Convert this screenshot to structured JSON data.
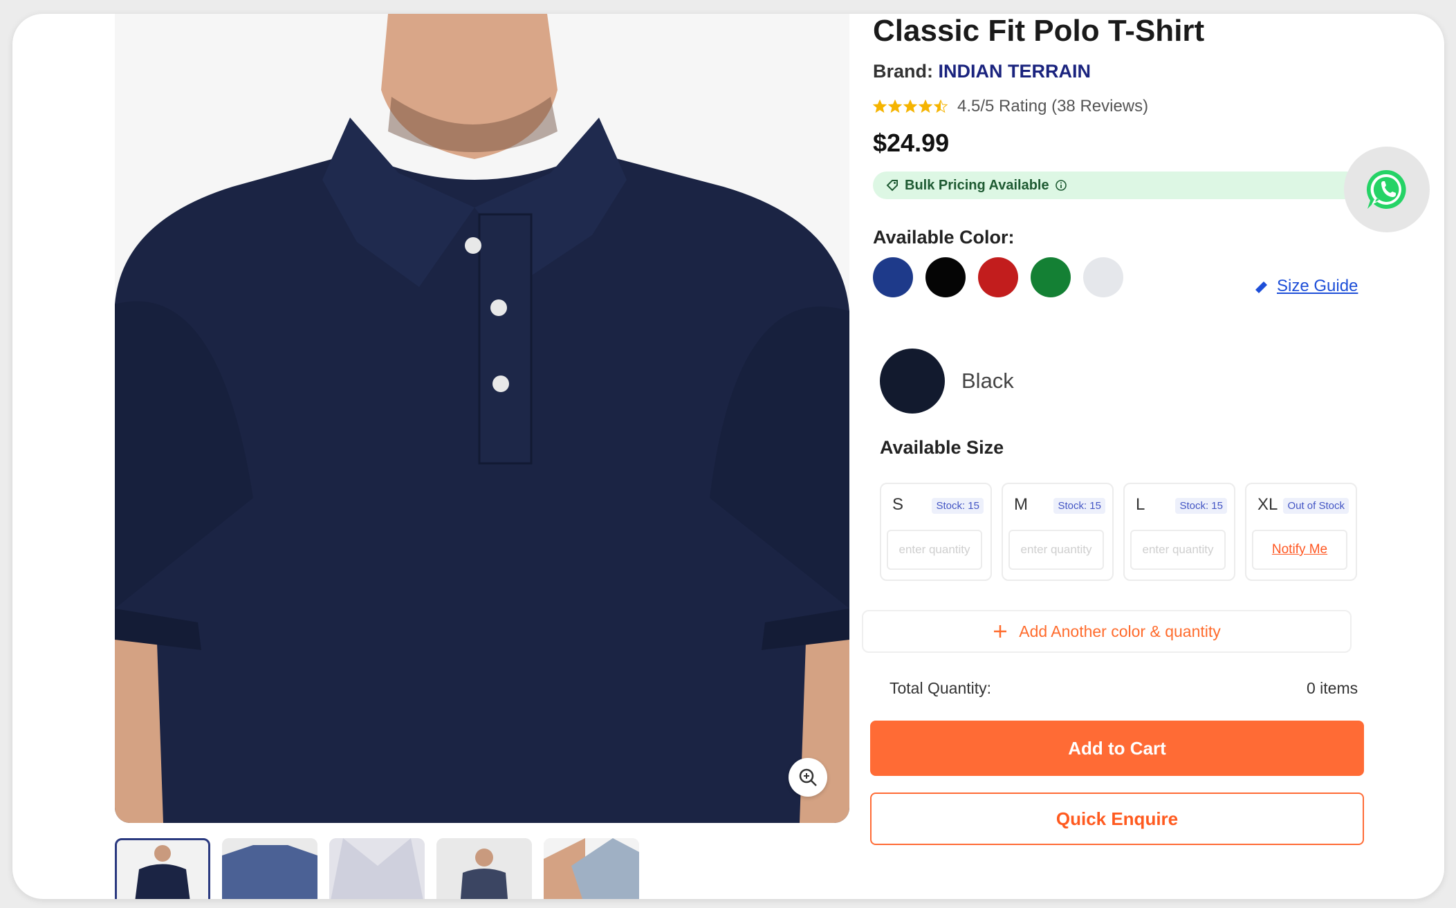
{
  "product": {
    "title": "Classic Fit Polo T-Shirt",
    "brand_label": "Brand:",
    "brand_name": "INDIAN TERRAIN",
    "rating_text": "4.5/5 Rating (38 Reviews)",
    "rating_value": 4.5,
    "rating_max": 5,
    "price": "$24.99",
    "bulk_label": "Bulk Pricing Available"
  },
  "colors": {
    "heading": "Available  Color:",
    "swatches": [
      {
        "name": "blue",
        "hex": "#1e3a8a"
      },
      {
        "name": "black",
        "hex": "#050505"
      },
      {
        "name": "red",
        "hex": "#c21d1d"
      },
      {
        "name": "green",
        "hex": "#148034"
      },
      {
        "name": "white",
        "hex": "#e5e7eb"
      }
    ],
    "selected_name": "Black",
    "selected_hex": "#121a2e"
  },
  "size_guide_label": "Size Guide",
  "sizes": {
    "heading": "Available Size",
    "items": [
      {
        "size": "S",
        "stock": "Stock: 15",
        "placeholder": "enter quantity"
      },
      {
        "size": "M",
        "stock": "Stock: 15",
        "placeholder": "enter quantity"
      },
      {
        "size": "L",
        "stock": "Stock: 15",
        "placeholder": "enter quantity"
      },
      {
        "size": "XL",
        "stock": "Out of Stock",
        "notify": "Notify Me"
      }
    ]
  },
  "add_another_label": "Add Another color & quantity",
  "total": {
    "label": "Total Quantity:",
    "value": "0 items"
  },
  "buttons": {
    "add_to_cart": "Add to Cart",
    "quick_enquire": "Quick Enquire"
  },
  "icons": [
    "zoom-icon",
    "whatsapp-icon",
    "tag-icon",
    "info-icon",
    "ruler-icon",
    "plus-icon",
    "star-icon"
  ],
  "theme": {
    "accent": "#ff6b35",
    "brand": "#1a237e",
    "link": "#1d4ed8",
    "bulk_bg": "#ddf7e4",
    "shirt": "#1b2444"
  }
}
